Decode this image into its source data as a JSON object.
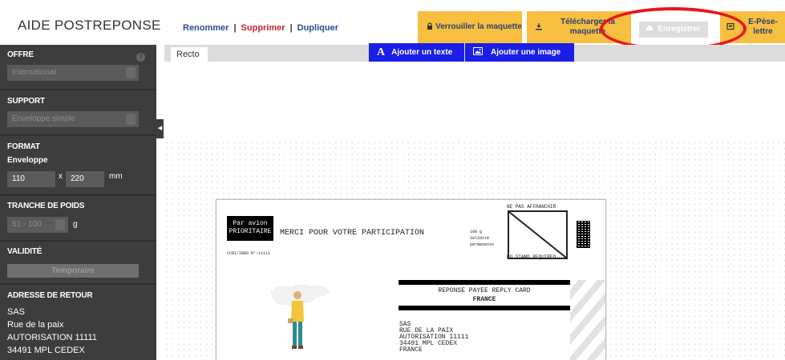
{
  "header": {
    "app_title": "AIDE POSTREPONSE",
    "links": {
      "rename": "Renommer",
      "delete": "Supprimer",
      "duplicate": "Dupliquer",
      "separator": "|"
    },
    "buttons": {
      "lock": "Verrouiller la maquette",
      "download": "Télécharger la maquette",
      "save": "Enregistrer",
      "pese": "E-Pèse-lettre"
    }
  },
  "sidebar": {
    "offre": {
      "title": "OFFRE",
      "value": "International"
    },
    "support": {
      "title": "SUPPORT",
      "value": "Enveloppe simple"
    },
    "format": {
      "title": "FORMAT",
      "subtitle": "Enveloppe",
      "width": "110",
      "x": "x",
      "height": "220",
      "unit": "mm"
    },
    "tranche": {
      "title": "TRANCHE DE POIDS",
      "value": "51 - 100",
      "unit": "g"
    },
    "validite": {
      "title": "VALIDITÉ",
      "button": "Temporaire"
    },
    "adresse": {
      "title": "ADRESSE DE RETOUR",
      "lines": [
        "SAS",
        "Rue de la paix",
        "AUTORISATION 11111",
        "34491 MPL CEDEX"
      ]
    }
  },
  "canvas": {
    "tab": "Recto",
    "tools": {
      "add_text": "Ajouter un texte",
      "add_image": "Ajouter une image"
    }
  },
  "envelope": {
    "par_avion": [
      "Par avion",
      "PRIORITAIRE"
    ],
    "message": "MERCI POUR VOTRE PARTICIPATION",
    "ccri": "CCRI/IBRS N°:11111",
    "poids": [
      "100 g",
      "Validité",
      "permanente"
    ],
    "ne_pas": "NE PAS AFFRANCHIR",
    "no_stamp": "NO STAMP REQUIRED",
    "reply_title": "REPONSE PAYEE REPLY CARD",
    "reply_country": "FRANCE",
    "reply_address": [
      "SAS",
      "RUE DE LA PAIX",
      "AUTORISATION 11111",
      "34491 MPL CEDEX",
      "FRANCE"
    ]
  },
  "colors": {
    "accent_yellow": "#f7bf3f",
    "tool_blue": "#1a1ee6",
    "sidebar": "#3d3d3d",
    "highlight": "#e8161a"
  }
}
